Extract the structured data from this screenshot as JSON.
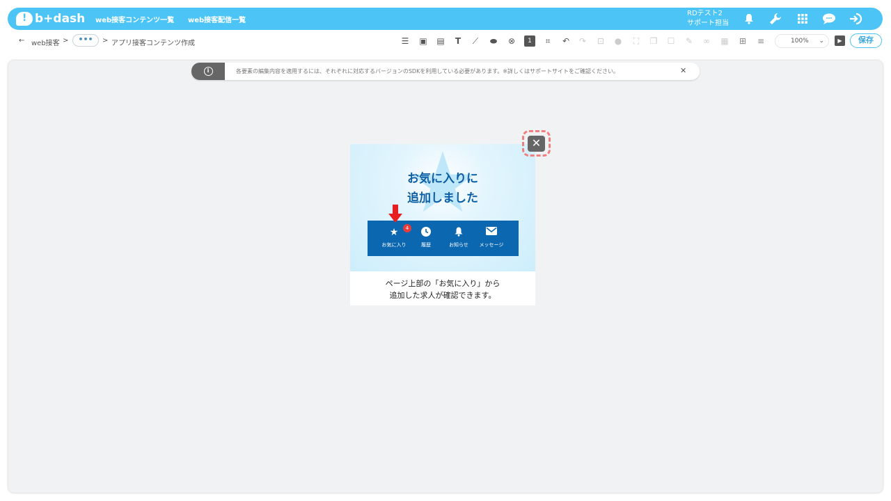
{
  "app": {
    "logo_text": "b+dash"
  },
  "topnav": {
    "item1": "web接客コンテンツ一覧",
    "item2": "web接客配信一覧"
  },
  "user": {
    "name": "RDテスト2",
    "role": "サポート担当"
  },
  "header_icons": [
    "bell-icon",
    "wrench-icon",
    "grid-icon",
    "chat-icon",
    "logout-icon"
  ],
  "breadcrumb": {
    "back_arrow": "←",
    "root": "web接客",
    "sep": ">",
    "more": "•••",
    "current": "アプリ接客コンテンツ作成"
  },
  "zoom": {
    "value": "100%"
  },
  "save_label": "保存",
  "notice": {
    "text": "各要素の編集内容を適用するには、それぞれに対応するバージョンのSDKを利用している必要があります。※詳しくはサポートサイトをご確認ください。",
    "close": "✕"
  },
  "popup": {
    "title_line1": "お気に入りに",
    "title_line2": "追加しました",
    "tabs": [
      {
        "label": "お気に入り",
        "icon": "star-icon"
      },
      {
        "label": "履歴",
        "icon": "clock-icon"
      },
      {
        "label": "お知らせ",
        "icon": "bell-icon"
      },
      {
        "label": "メッセージ",
        "icon": "mail-icon"
      }
    ],
    "badge_count": "4",
    "desc_line1": "ページ上部の「お気に入り」から",
    "desc_line2": "追加した求人が確認できます。",
    "close": "✕"
  },
  "colors": {
    "accent": "#4cc4f5",
    "tabbar": "#0a67b0",
    "title": "#0d5ea3",
    "badge": "#e83b3b",
    "arrow": "#e62020"
  }
}
